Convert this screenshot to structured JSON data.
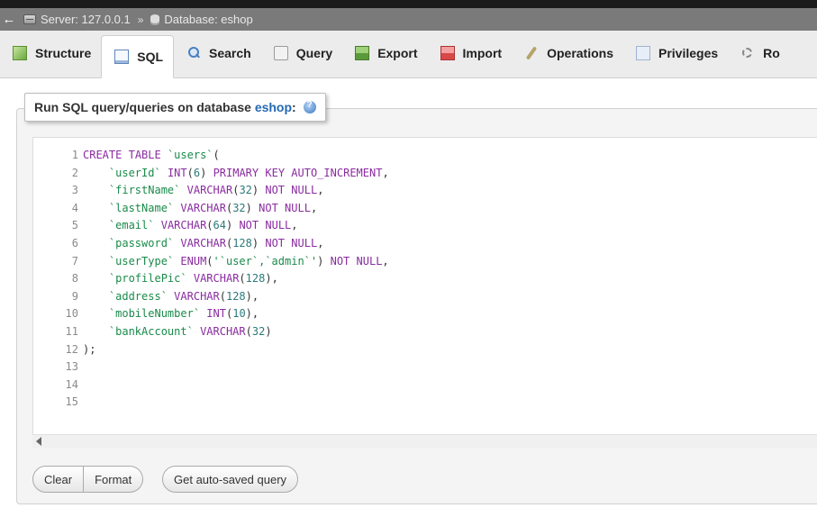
{
  "breadcrumb": {
    "server": "Server: 127.0.0.1",
    "separator": "»",
    "database": "Database: eshop"
  },
  "tabs": [
    {
      "label": "Structure",
      "icon": "structure-icon"
    },
    {
      "label": "SQL",
      "icon": "sql-icon"
    },
    {
      "label": "Search",
      "icon": "search-icon"
    },
    {
      "label": "Query",
      "icon": "query-icon"
    },
    {
      "label": "Export",
      "icon": "export-icon"
    },
    {
      "label": "Import",
      "icon": "import-icon"
    },
    {
      "label": "Operations",
      "icon": "operations-icon"
    },
    {
      "label": "Privileges",
      "icon": "privileges-icon"
    },
    {
      "label": "Ro",
      "icon": "routines-icon"
    }
  ],
  "active_tab": "SQL",
  "query_panel": {
    "legend_prefix": "Run SQL query/queries on database ",
    "legend_db": "eshop",
    "legend_suffix": ":"
  },
  "editor": {
    "line_numbers": [
      "1",
      "2",
      "3",
      "4",
      "5",
      "6",
      "7",
      "8",
      "9",
      "10",
      "11",
      "12",
      "13",
      "14",
      "15"
    ],
    "lines": [
      "CREATE TABLE `users`(",
      "    `userId` INT(6) PRIMARY KEY AUTO_INCREMENT,",
      "    `firstName` VARCHAR(32) NOT NULL,",
      "    `lastName` VARCHAR(32) NOT NULL,",
      "    `email` VARCHAR(64) NOT NULL,",
      "    `password` VARCHAR(128) NOT NULL,",
      "    `userType` ENUM('`user`,`admin`') NOT NULL,",
      "    `profilePic` VARCHAR(128),",
      "    `address` VARCHAR(128),",
      "    `mobileNumber` INT(10),",
      "    `bankAccount` VARCHAR(32)",
      ");",
      "",
      "",
      ""
    ]
  },
  "buttons": {
    "clear": "Clear",
    "format": "Format",
    "autosaved": "Get auto-saved query"
  }
}
